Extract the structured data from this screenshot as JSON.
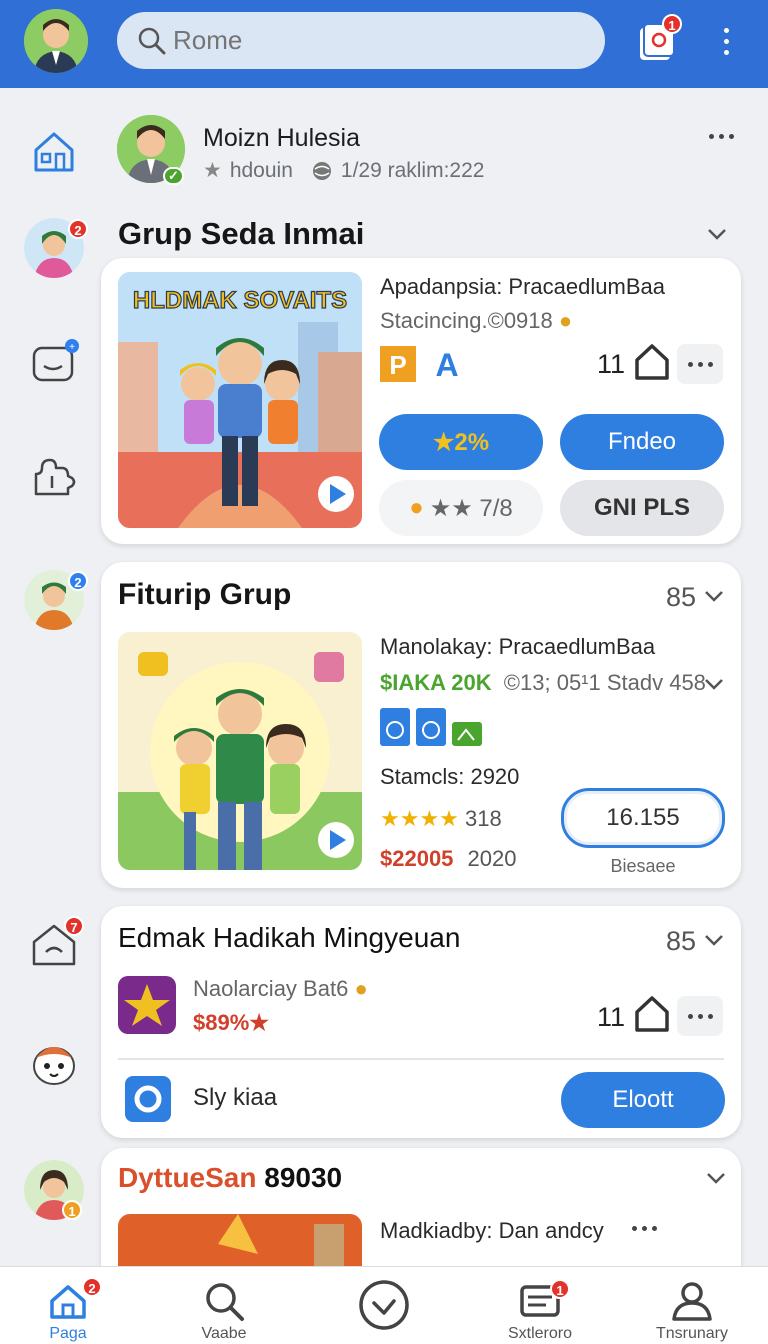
{
  "search": {
    "placeholder": "Rome"
  },
  "top_badge": "1",
  "profile": {
    "name": "Moizn Hulesia",
    "handle": "hdouin",
    "meta": "1/29 raklim:222"
  },
  "rail_badges": [
    "2",
    "",
    "7",
    "2",
    "1"
  ],
  "sections": [
    {
      "title": "Grup Seda Inmai",
      "line1": "Apadanpsia: PracaedlumBaa",
      "line2": "Stacincing.©0918",
      "count": "11",
      "primary_btn": "★2%",
      "secondary_btn": "Fndeo",
      "rating_btn": "★★ 7/8",
      "gray_btn": "GNI PLS",
      "art_text": "HLDMAK SOVAITS"
    },
    {
      "title": "Fiturip Grup",
      "count": "85",
      "line1": "Manolakay: PracaedlumBaa",
      "price_green": "$IAKA 20K",
      "line2": "©13; 05¹1 Stadv 458",
      "line3": "Stamcls: 2920",
      "stars": "★★★★",
      "stars_value": "318",
      "price_red": "$22005",
      "year": "2020",
      "outline_btn": "16.155",
      "btn_caption": "Biesaee"
    },
    {
      "title": "Edmak Hadikah Mingyeuan",
      "count": "85",
      "line1": "Naolarciay Bat6",
      "price_red": "$89%★",
      "right_count": "11",
      "row_label": "Sly kiaa",
      "row_btn": "Eloott"
    },
    {
      "title_red": "DyttueSan",
      "title_num": "89030",
      "line1": "Madkiadby: Dan andcy"
    }
  ],
  "nav": [
    {
      "label": "Paga",
      "badge": "2"
    },
    {
      "label": "Vaabe",
      "badge": ""
    },
    {
      "label": "",
      "badge": ""
    },
    {
      "label": "Sxtleroro",
      "badge": "1"
    },
    {
      "label": "Tnsrunary",
      "badge": ""
    }
  ],
  "colors": {
    "primary": "#2f6fd6",
    "accent": "#2f7fe0",
    "price_green": "#4aa52e",
    "price_red": "#d0402a",
    "title_red": "#d9502a",
    "badge": "#e2322a"
  }
}
